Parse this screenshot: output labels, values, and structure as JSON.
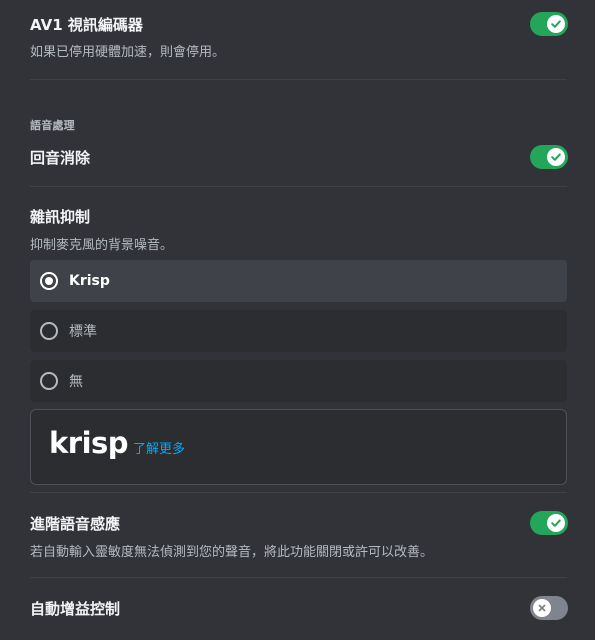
{
  "av1": {
    "title": "AV1 視訊編碼器",
    "description": "如果已停用硬體加速，則會停用。",
    "enabled": true
  },
  "voice_processing": {
    "section_label": "語音處理",
    "echo_cancellation": {
      "title": "回音消除",
      "enabled": true
    }
  },
  "noise_suppression": {
    "title": "雜訊抑制",
    "description": "抑制麥克風的背景噪音。",
    "options": [
      {
        "label": "Krisp",
        "selected": true
      },
      {
        "label": "標準",
        "selected": false
      },
      {
        "label": "無",
        "selected": false
      }
    ],
    "krisp_card": {
      "logo": "krisp",
      "learn_more": "了解更多"
    }
  },
  "advanced_voice_activity": {
    "title": "進階語音感應",
    "description": "若自動輸入靈敏度無法偵測到您的聲音，將此功能關閉或許可以改善。",
    "enabled": true
  },
  "automatic_gain_control": {
    "title": "自動增益控制",
    "enabled": false
  },
  "colors": {
    "background": "#313338",
    "toggle_on": "#23a55a",
    "toggle_off": "#80848e",
    "link": "#00a8fc",
    "selected_row": "#404249"
  }
}
